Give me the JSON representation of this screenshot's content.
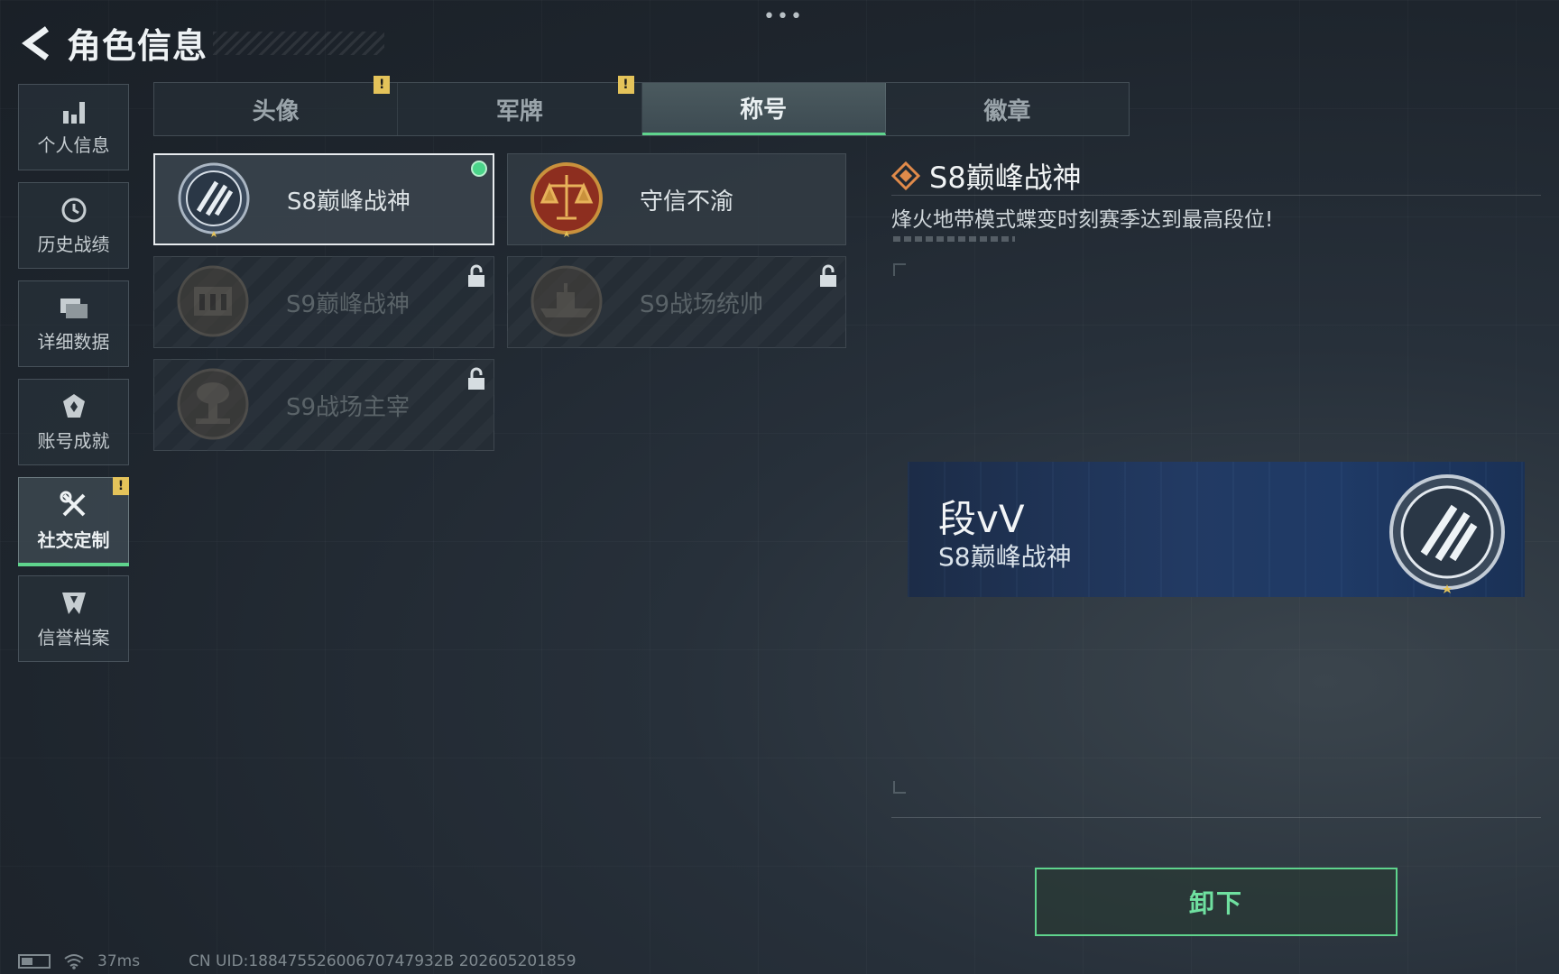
{
  "header": {
    "title": "角色信息",
    "more": "•••"
  },
  "sidebar": {
    "items": [
      {
        "label": "个人信息",
        "icon": "bar-chart-icon"
      },
      {
        "label": "历史战绩",
        "icon": "history-clock-icon"
      },
      {
        "label": "详细数据",
        "icon": "folder-data-icon"
      },
      {
        "label": "账号成就",
        "icon": "achievement-badge-icon"
      },
      {
        "label": "社交定制",
        "icon": "tools-icon",
        "active": true,
        "warning": "!"
      },
      {
        "label": "信誉档案",
        "icon": "credit-shield-icon"
      }
    ]
  },
  "tabs": [
    {
      "label": "头像",
      "warning": "!"
    },
    {
      "label": "军牌",
      "warning": "!"
    },
    {
      "label": "称号",
      "active": true
    },
    {
      "label": "徽章"
    }
  ],
  "titles": [
    {
      "name": "S8巅峰战神",
      "emblem": "wings-laurel-emblem",
      "state": "equipped"
    },
    {
      "name": "守信不渝",
      "emblem": "scales-emblem",
      "state": "unlocked"
    },
    {
      "name": "S9巅峰战神",
      "emblem": "fortress-emblem",
      "state": "locked"
    },
    {
      "name": "S9战场统帅",
      "emblem": "warship-emblem",
      "state": "locked"
    },
    {
      "name": "S9战场主宰",
      "emblem": "mushroom-cloud-emblem",
      "state": "locked"
    }
  ],
  "detail": {
    "name": "S8巅峰战神",
    "description": "烽火地带模式蝶变时刻赛季达到最高段位!"
  },
  "banner": {
    "player_name": "段vV",
    "title": "S8巅峰战神"
  },
  "action": {
    "label": "卸下"
  },
  "status": {
    "ping": "37ms",
    "uid": "CN UID:18847552600670747932B 202605201859"
  },
  "colors": {
    "accent_green": "#5fd48d",
    "warning_yellow": "#e4c35a",
    "diamond_orange": "#e08a4a"
  }
}
